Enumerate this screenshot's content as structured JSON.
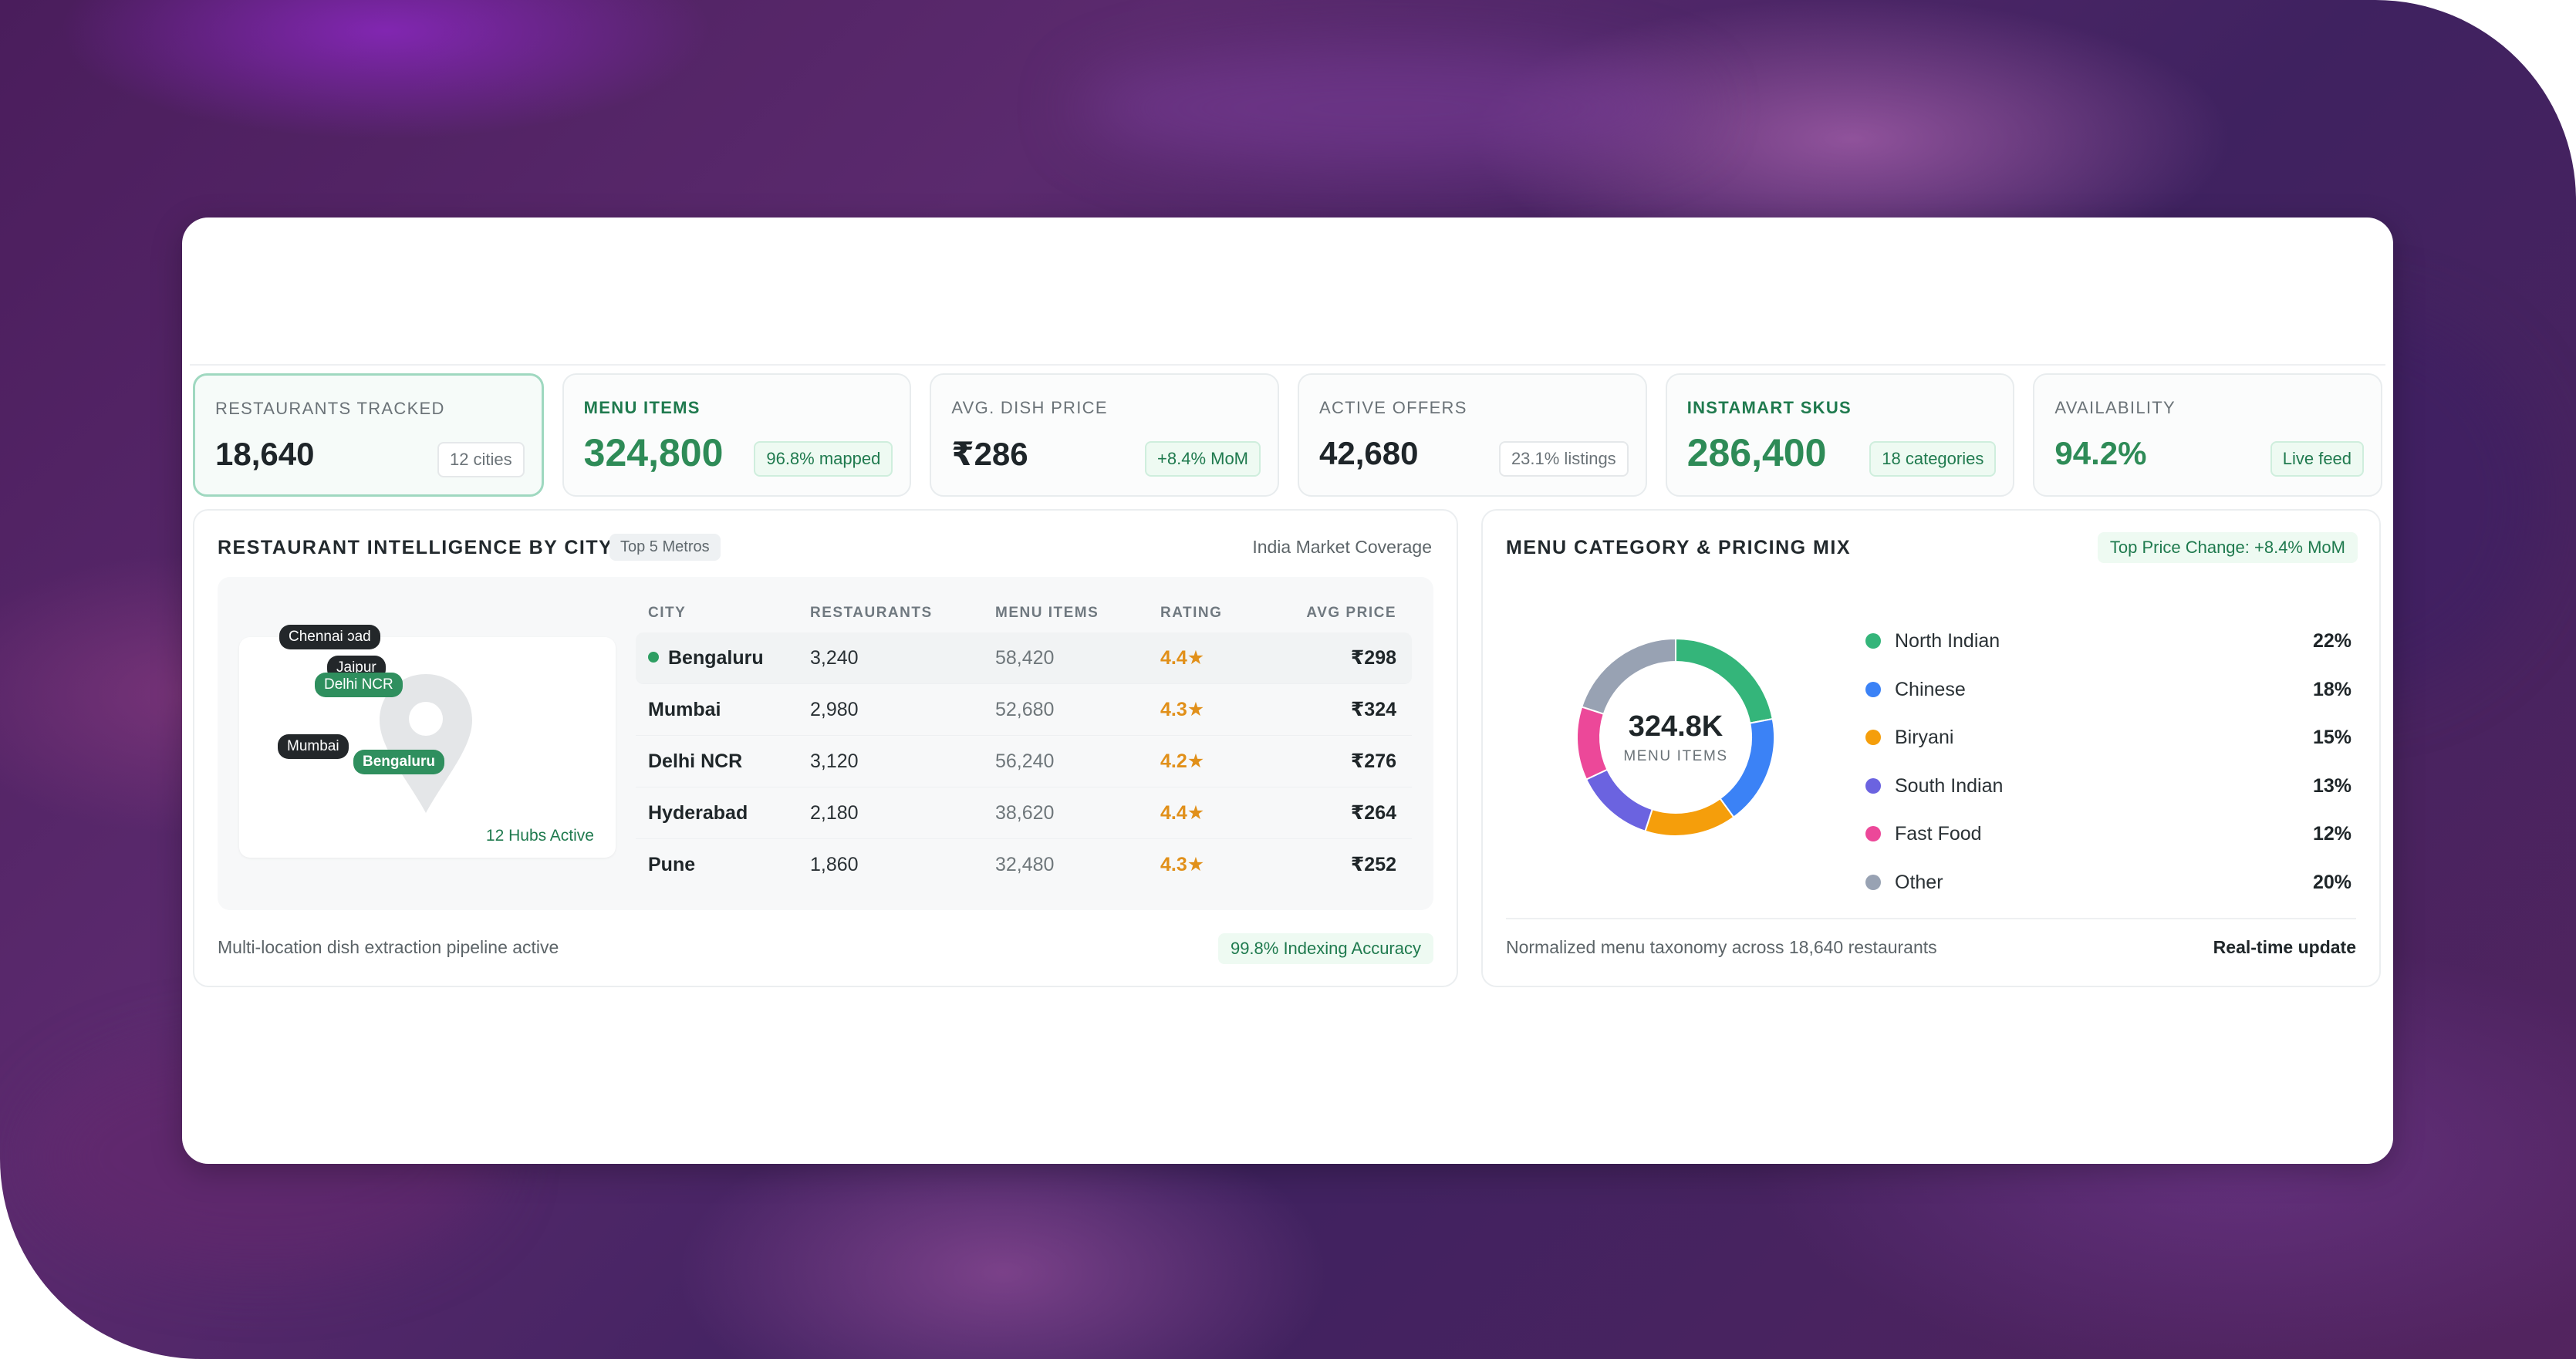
{
  "kpis": [
    {
      "label": "RESTAURANTS TRACKED",
      "value": "18,640",
      "tag": "12 cities",
      "accent": "none"
    },
    {
      "label": "MENU ITEMS",
      "value": "324,800",
      "tag": "96.8% mapped",
      "accent": "green"
    },
    {
      "label": "AVG. DISH PRICE",
      "value": "₹286",
      "tag": "+8.4% MoM",
      "accent": "tag"
    },
    {
      "label": "ACTIVE OFFERS",
      "value": "42,680",
      "tag": "23.1% listings",
      "accent": "none"
    },
    {
      "label": "INSTAMART SKUS",
      "value": "286,400",
      "tag": "18 categories",
      "accent": "green"
    },
    {
      "label": "AVAILABILITY",
      "value": "94.2%",
      "tag": "Live feed",
      "accent": "value"
    }
  ],
  "city_panel": {
    "title": "RESTAURANT INTELLIGENCE BY CITY",
    "chip": "Top 5 Metros",
    "meta": "India Market Coverage",
    "map": {
      "labels": {
        "chennai": "Chennai",
        "hyderabad_partial": "ɔad",
        "delhi": "Delhi NCR",
        "jaipur_partial": "Jaipur",
        "mumbai": "Mumbai",
        "bengaluru": "Bengaluru"
      },
      "hubs": "12 Hubs Active"
    },
    "table": {
      "headers": [
        "CITY",
        "RESTAURANTS",
        "MENU ITEMS",
        "RATING",
        "AVG PRICE"
      ],
      "rows": [
        {
          "city": "Bengaluru",
          "restaurants": "3,240",
          "menu_items": "58,420",
          "rating": "4.4★",
          "avg_price": "₹298"
        },
        {
          "city": "Mumbai",
          "restaurants": "2,980",
          "menu_items": "52,680",
          "rating": "4.3★",
          "avg_price": "₹324"
        },
        {
          "city": "Delhi NCR",
          "restaurants": "3,120",
          "menu_items": "56,240",
          "rating": "4.2★",
          "avg_price": "₹276"
        },
        {
          "city": "Hyderabad",
          "restaurants": "2,180",
          "menu_items": "38,620",
          "rating": "4.4★",
          "avg_price": "₹264"
        },
        {
          "city": "Pune",
          "restaurants": "1,860",
          "menu_items": "32,480",
          "rating": "4.3★",
          "avg_price": "₹252"
        }
      ]
    },
    "footer": "Multi-location dish extraction pipeline active",
    "footer_chip": "99.8% Indexing Accuracy"
  },
  "mix_panel": {
    "title": "MENU CATEGORY & PRICING MIX",
    "chip": "Top Price Change: +8.4% MoM",
    "donut_value": "324.8K",
    "donut_label": "MENU ITEMS",
    "footer": "Normalized menu taxonomy across 18,640 restaurants",
    "footer_bold": "Real-time update"
  },
  "chart_data": {
    "type": "pie",
    "categories": [
      "North Indian",
      "Chinese",
      "Biryani",
      "South Indian",
      "Fast Food",
      "Other"
    ],
    "values": [
      22,
      18,
      15,
      13,
      12,
      20
    ],
    "value_labels": [
      "22%",
      "18%",
      "15%",
      "13%",
      "12%",
      "20%"
    ],
    "colors": [
      "#34b57a",
      "#3b82f6",
      "#f59e0b",
      "#6b63e0",
      "#ec4899",
      "#98a2b3"
    ],
    "legend": "right"
  },
  "colors": {
    "accent_green": "#2e8b57",
    "rating_orange": "#e1901a",
    "backdrop_purple": "#4a1d5c"
  }
}
